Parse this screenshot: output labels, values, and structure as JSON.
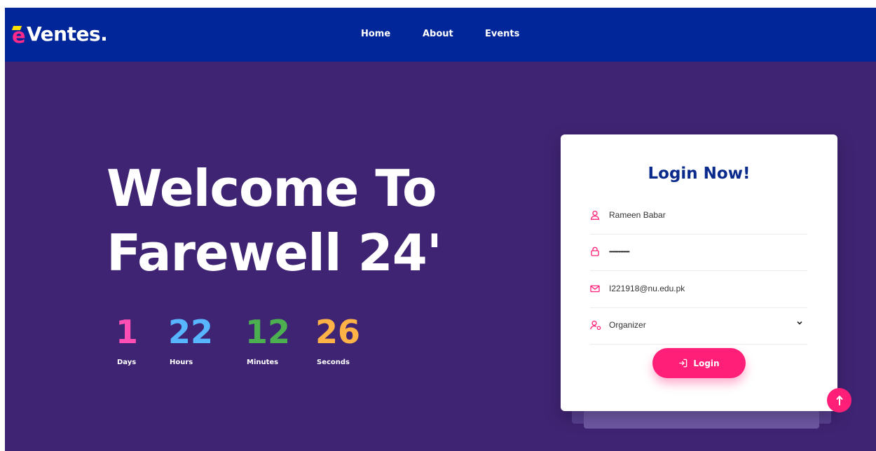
{
  "brand": {
    "logo_text": "Ventes.",
    "logo_initial": "e"
  },
  "nav": {
    "items": [
      {
        "label": "Home"
      },
      {
        "label": "About"
      },
      {
        "label": "Events"
      }
    ]
  },
  "hero": {
    "title_line1": "Welcome To",
    "title_line2": "Farewell 24'"
  },
  "countdown": {
    "items": [
      {
        "value": "1",
        "label": "Days",
        "color": "#ff4fb4"
      },
      {
        "value": "22",
        "label": "Hours",
        "color": "#57b6ff"
      },
      {
        "value": "12",
        "label": "Minutes",
        "color": "#4caf50"
      },
      {
        "value": "26",
        "label": "Seconds",
        "color": "#ffb347"
      }
    ]
  },
  "login": {
    "title": "Login Now!",
    "name_value": "Rameen Babar",
    "password_value": "••••••••••••••••",
    "email_value": "I221918@nu.edu.pk",
    "role_value": "Organizer",
    "button_label": "Login",
    "icons": {
      "name": "user-icon",
      "password": "lock-icon",
      "email": "mail-icon",
      "role": "user-role-icon",
      "button": "login-icon"
    }
  },
  "colors": {
    "navbar": "#002699",
    "background": "#3f2473",
    "accent": "#ff1f78",
    "title": "#0a2a8c"
  }
}
